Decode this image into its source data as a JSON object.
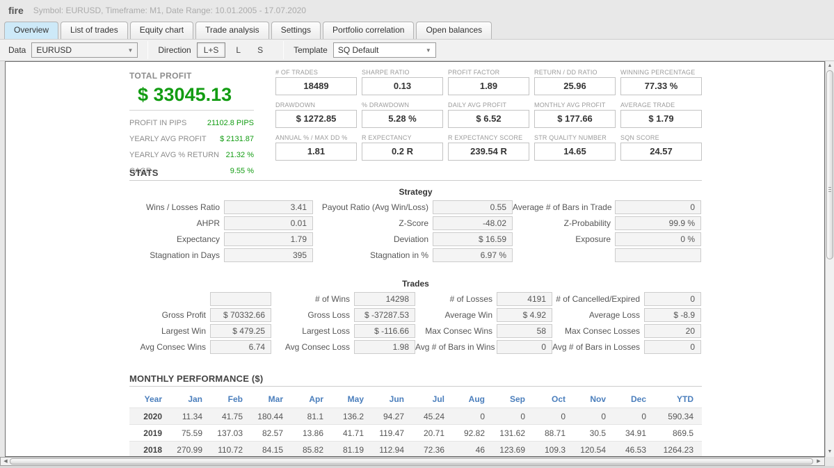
{
  "header": {
    "app_title": "fire",
    "subtitle": "Symbol: EURUSD, Timeframe: M1, Date Range: 10.01.2005 - 17.07.2020"
  },
  "tabs": [
    {
      "label": "Overview"
    },
    {
      "label": "List of trades"
    },
    {
      "label": "Equity chart"
    },
    {
      "label": "Trade analysis"
    },
    {
      "label": "Settings"
    },
    {
      "label": "Portfolio correlation"
    },
    {
      "label": "Open balances"
    }
  ],
  "toolbar": {
    "data_label": "Data",
    "data_value": "EURUSD",
    "direction_label": "Direction",
    "direction_options": [
      "L+S",
      "L",
      "S"
    ],
    "direction_selected": "L+S",
    "template_label": "Template",
    "template_value": "SQ Default"
  },
  "colors": {
    "profit_green": "#129c12",
    "header_blue": "#4a7ebc",
    "tab_active_bg": "#cde9f8"
  },
  "total_profit": {
    "label": "TOTAL PROFIT",
    "value": "$ 33045.13",
    "rows": [
      {
        "label": "PROFIT IN PIPS",
        "value": "21102.8 PIPS"
      },
      {
        "label": "YEARLY AVG PROFIT",
        "value": "$ 2131.87"
      },
      {
        "label": "YEARLY AVG % RETURN",
        "value": "21.32 %"
      },
      {
        "label": "CAGR",
        "value": "9.55 %"
      }
    ]
  },
  "kpis": {
    "rows": [
      [
        {
          "label": "# OF TRADES",
          "value": "18489"
        },
        {
          "label": "SHARPE RATIO",
          "value": "0.13"
        },
        {
          "label": "PROFIT FACTOR",
          "value": "1.89"
        },
        {
          "label": "RETURN / DD RATIO",
          "value": "25.96"
        },
        {
          "label": "WINNING PERCENTAGE",
          "value": "77.33 %"
        }
      ],
      [
        {
          "label": "DRAWDOWN",
          "value": "$ 1272.85"
        },
        {
          "label": "% DRAWDOWN",
          "value": "5.28 %"
        },
        {
          "label": "DAILY AVG PROFIT",
          "value": "$ 6.52"
        },
        {
          "label": "MONTHLY AVG PROFIT",
          "value": "$ 177.66"
        },
        {
          "label": "AVERAGE TRADE",
          "value": "$ 1.79"
        }
      ],
      [
        {
          "label": "ANNUAL % / MAX DD %",
          "value": "1.81"
        },
        {
          "label": "R EXPECTANCY",
          "value": "0.2 R"
        },
        {
          "label": "R EXPECTANCY SCORE",
          "value": "239.54 R"
        },
        {
          "label": "STR QUALITY NUMBER",
          "value": "14.65"
        },
        {
          "label": "SQN SCORE",
          "value": "24.57"
        }
      ]
    ]
  },
  "stats": {
    "section_title": "STATS",
    "strategy": {
      "title": "Strategy",
      "rows": [
        [
          {
            "label": "Wins / Losses Ratio",
            "value": "3.41"
          },
          {
            "label": "Payout Ratio (Avg Win/Loss)",
            "value": "0.55"
          },
          {
            "label": "Average # of Bars in Trade",
            "value": "0"
          }
        ],
        [
          {
            "label": "AHPR",
            "value": "0.01"
          },
          {
            "label": "Z-Score",
            "value": "-48.02"
          },
          {
            "label": "Z-Probability",
            "value": "99.9 %"
          }
        ],
        [
          {
            "label": "Expectancy",
            "value": "1.79"
          },
          {
            "label": "Deviation",
            "value": "$ 16.59"
          },
          {
            "label": "Exposure",
            "value": "0 %"
          }
        ],
        [
          {
            "label": "Stagnation in Days",
            "value": "395"
          },
          {
            "label": "Stagnation in %",
            "value": "6.97 %"
          },
          {
            "label": "",
            "value": ""
          }
        ]
      ]
    },
    "trades": {
      "title": "Trades",
      "rows": [
        [
          {
            "label": "",
            "value": ""
          },
          {
            "label": "# of Wins",
            "value": "14298"
          },
          {
            "label": "# of Losses",
            "value": "4191"
          },
          {
            "label": "# of Cancelled/Expired",
            "value": "0"
          }
        ],
        [
          {
            "label": "Gross Profit",
            "value": "$ 70332.66"
          },
          {
            "label": "Gross Loss",
            "value": "$ -37287.53"
          },
          {
            "label": "Average Win",
            "value": "$ 4.92"
          },
          {
            "label": "Average Loss",
            "value": "$ -8.9"
          }
        ],
        [
          {
            "label": "Largest Win",
            "value": "$ 479.25"
          },
          {
            "label": "Largest Loss",
            "value": "$ -116.66"
          },
          {
            "label": "Max Consec Wins",
            "value": "58"
          },
          {
            "label": "Max Consec Losses",
            "value": "20"
          }
        ],
        [
          {
            "label": "Avg Consec Wins",
            "value": "6.74"
          },
          {
            "label": "Avg Consec Loss",
            "value": "1.98"
          },
          {
            "label": "Avg # of Bars in Wins",
            "value": "0"
          },
          {
            "label": "Avg # of Bars in Losses",
            "value": "0"
          }
        ]
      ]
    }
  },
  "monthly": {
    "section_title": "MONTHLY PERFORMANCE ($)",
    "columns": [
      "Year",
      "Jan",
      "Feb",
      "Mar",
      "Apr",
      "May",
      "Jun",
      "Jul",
      "Aug",
      "Sep",
      "Oct",
      "Nov",
      "Dec",
      "YTD"
    ],
    "rows": [
      {
        "year": "2020",
        "values": [
          "11.34",
          "41.75",
          "180.44",
          "81.1",
          "136.2",
          "94.27",
          "45.24",
          "0",
          "0",
          "0",
          "0",
          "0",
          "590.34"
        ]
      },
      {
        "year": "2019",
        "values": [
          "75.59",
          "137.03",
          "82.57",
          "13.86",
          "41.71",
          "119.47",
          "20.71",
          "92.82",
          "131.62",
          "88.71",
          "30.5",
          "34.91",
          "869.5"
        ]
      },
      {
        "year": "2018",
        "values": [
          "270.99",
          "110.72",
          "84.15",
          "85.82",
          "81.19",
          "112.94",
          "72.36",
          "46",
          "123.69",
          "109.3",
          "120.54",
          "46.53",
          "1264.23"
        ]
      }
    ]
  }
}
